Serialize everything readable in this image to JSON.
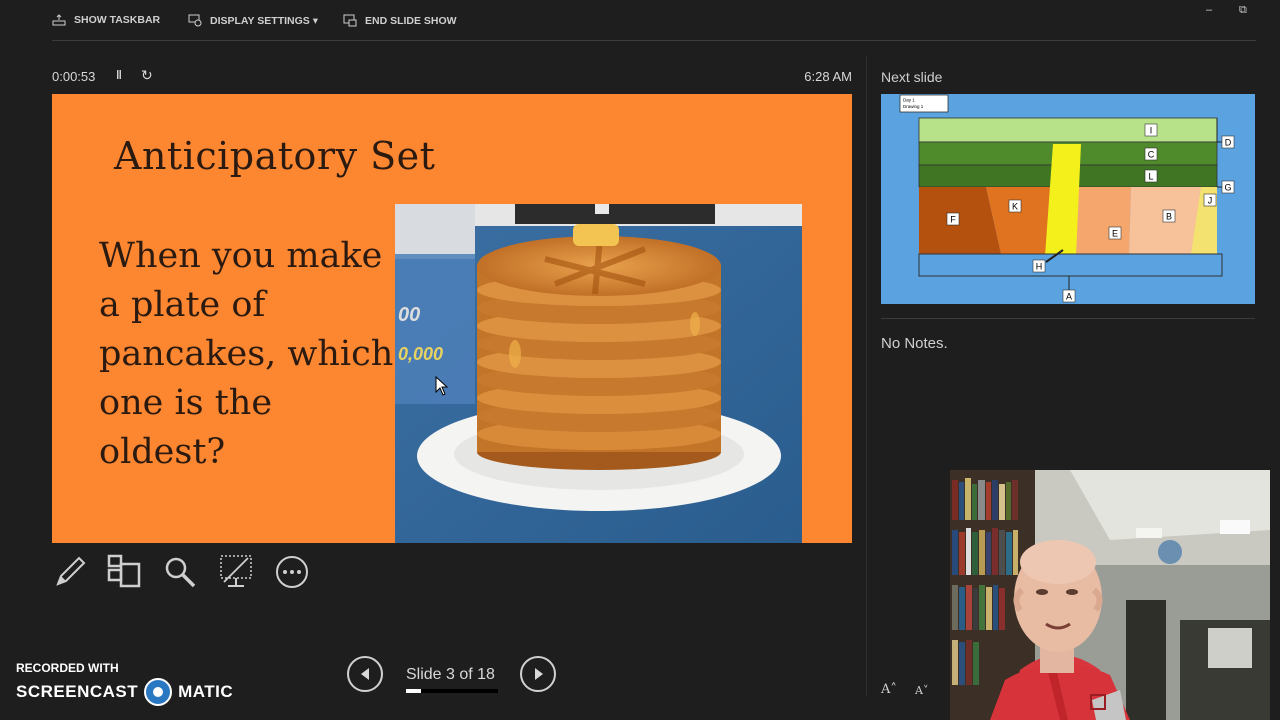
{
  "topbar": {
    "show_taskbar": "SHOW TASKBAR",
    "display_settings": "DISPLAY SETTINGS ▾",
    "end_slide_show": "END SLIDE SHOW",
    "minimize_glyph": "–",
    "restore_glyph": "⧉"
  },
  "presenter": {
    "timer": "0:00:53",
    "pause_glyph": "‖",
    "reset_glyph": "↻",
    "clock": "6:28 AM",
    "next_slide_label": "Next slide",
    "notes": "No Notes.",
    "slide_counter": "Slide 3 of 18",
    "progress_fraction": 0.167,
    "font_increase": "A˄",
    "font_decrease": "A˅"
  },
  "slide": {
    "title": "Anticipatory Set",
    "body_lines": [
      "When you make",
      "a plate of",
      "pancakes, which",
      "one is the",
      "oldest?"
    ],
    "photo_text_1": "00",
    "photo_text_2": "0,000",
    "background": "#fd8631"
  },
  "next_slide": {
    "header_line_1": "Day 1",
    "header_line_2": "Drawing 1",
    "labels": [
      "I",
      "D",
      "C",
      "L",
      "G",
      "K",
      "F",
      "J",
      "B",
      "E",
      "H",
      "A"
    ]
  },
  "tools": [
    "pen-icon",
    "slides-grid-icon",
    "zoom-icon",
    "screen-icon",
    "more-icon"
  ],
  "watermark": {
    "recorded_with": "RECORDED WITH",
    "brand_left": "SCREENCAST",
    "brand_right": "MATIC"
  }
}
